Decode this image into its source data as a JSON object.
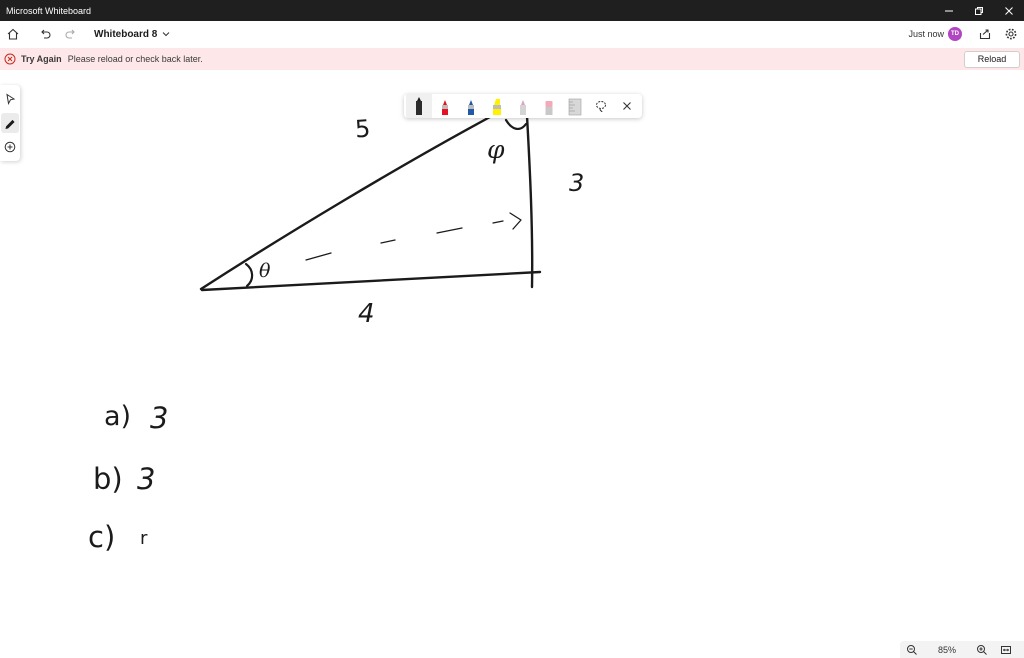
{
  "window": {
    "title": "Microsoft Whiteboard",
    "controls": [
      "minimize-icon",
      "restore-icon",
      "close-icon"
    ]
  },
  "header": {
    "board_name": "Whiteboard 8",
    "last_saved": "Just now",
    "avatar_initials": "TD",
    "avatar_color": "#b146c2"
  },
  "banner": {
    "title": "Try Again",
    "message": "Please reload or check back later.",
    "button_label": "Reload",
    "background": "#fde7e9",
    "icon_color": "#c42b1c"
  },
  "rail": {
    "tools": [
      "select-icon",
      "pen-icon",
      "add-icon"
    ],
    "active": "pen-icon"
  },
  "pen_toolbar": {
    "tools": [
      "black-pen",
      "red-pen",
      "blue-pen",
      "highlighter",
      "rainbow-pen",
      "eraser",
      "ruler",
      "lasso-icon",
      "close-icon"
    ],
    "colors": {
      "black": "#1b1b1b",
      "red": "#e81123",
      "blue": "#1e5aa8",
      "highlighter": "#fff100"
    }
  },
  "canvas": {
    "triangle_labels": {
      "hypotenuse": "5",
      "vertical_side": "3",
      "bottom_side": "4",
      "left_angle": "θ",
      "top_angle": "φ"
    },
    "answers": [
      {
        "label": "a)",
        "value": "3"
      },
      {
        "label": "b)",
        "value": "3"
      },
      {
        "label": "c)",
        "value": "r"
      }
    ]
  },
  "zoom": {
    "level": "85%"
  }
}
